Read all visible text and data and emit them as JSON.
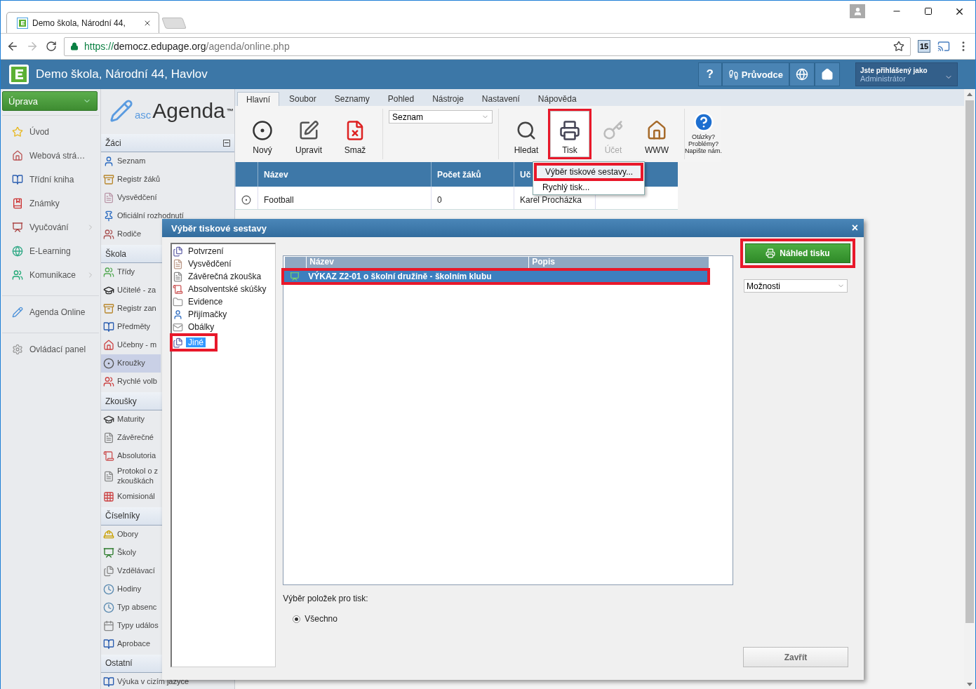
{
  "browser": {
    "tabs": [
      {
        "title": "Demo škola, Národní 44,",
        "selected": true
      }
    ],
    "url": {
      "scheme": "https://",
      "host": "democz.edupage.org",
      "path": "/agenda/online.php"
    },
    "extension_badge": "15"
  },
  "header": {
    "title": "Demo škola, Národní 44, Havlov",
    "help": "?",
    "guide": "Průvodce",
    "user_caption": "Jste přihlášený jako",
    "user_name": "Administrátor"
  },
  "sidebar": {
    "edit_button": "Úprava",
    "groups": [
      [
        {
          "label": "Úvod",
          "submenu": false
        },
        {
          "label": "Webová strá…",
          "submenu": false
        },
        {
          "label": "Třídní kniha",
          "submenu": false
        },
        {
          "label": "Známky",
          "submenu": false
        },
        {
          "label": "Vyučování",
          "submenu": true
        },
        {
          "label": "E-Learning",
          "submenu": false
        },
        {
          "label": "Komunikace",
          "submenu": true
        }
      ],
      [
        {
          "label": "Agenda Online",
          "submenu": false
        }
      ],
      [
        {
          "label": "Ovládací panel",
          "submenu": false
        }
      ]
    ]
  },
  "logo": {
    "prefix": "asc",
    "name": "Agenda",
    "mark": "™"
  },
  "nav": [
    {
      "title": "Žáci",
      "collapsible": true,
      "items": [
        {
          "label": "Seznam",
          "selected": false
        },
        {
          "label": "Registr žáků",
          "selected": false
        },
        {
          "label": "Vysvědčení",
          "selected": false
        },
        {
          "label": "Oficiální rozhodnutí",
          "selected": false
        },
        {
          "label": "Rodiče",
          "selected": false
        }
      ]
    },
    {
      "title": "Škola",
      "items": [
        {
          "label": "Třídy",
          "selected": false
        },
        {
          "label": "Učitelé - za",
          "selected": false
        },
        {
          "label": "Registr zan",
          "selected": false
        },
        {
          "label": "Předměty",
          "selected": false
        },
        {
          "label": "Učebny - m",
          "selected": false
        },
        {
          "label": "Kroužky",
          "selected": true
        },
        {
          "label": "Rychlé volb",
          "selected": false
        }
      ]
    },
    {
      "title": "Zkoušky",
      "items": [
        {
          "label": "Maturity",
          "selected": false
        },
        {
          "label": "Závěrečné",
          "selected": false
        },
        {
          "label": "Absolutoria",
          "selected": false
        },
        {
          "label": "Protokol o z\nzkouškách",
          "selected": false
        },
        {
          "label": "Komisionál",
          "selected": false
        }
      ]
    },
    {
      "title": "Číselníky",
      "items": [
        {
          "label": "Obory",
          "selected": false
        },
        {
          "label": "Školy",
          "selected": false
        },
        {
          "label": "Vzdělávací",
          "selected": false
        },
        {
          "label": "Hodiny",
          "selected": false
        },
        {
          "label": "Typ absenc",
          "selected": false
        },
        {
          "label": "Typy událos",
          "selected": false
        },
        {
          "label": "Aprobace",
          "selected": false
        }
      ]
    },
    {
      "title": "Ostatní",
      "items": [
        {
          "label": "Výuka v cizím jazyce",
          "selected": false
        }
      ]
    }
  ],
  "menu_tabs": [
    {
      "label": "Hlavní",
      "selected": true
    },
    {
      "label": "Soubor",
      "selected": false
    },
    {
      "label": "Seznamy",
      "selected": false
    },
    {
      "label": "Pohled",
      "selected": false
    },
    {
      "label": "Nástroje",
      "selected": false
    },
    {
      "label": "Nastavení",
      "selected": false
    },
    {
      "label": "Nápověda",
      "selected": false
    }
  ],
  "toolbar": {
    "edit_buttons": [
      {
        "label": "Nový",
        "disabled": false,
        "active": false,
        "highlighted": false
      },
      {
        "label": "Upravit",
        "disabled": false,
        "active": false,
        "highlighted": false
      },
      {
        "label": "Smaž",
        "disabled": false,
        "active": false,
        "highlighted": false
      }
    ],
    "view_select": "Seznam",
    "tool_buttons": [
      {
        "label": "Hledat",
        "disabled": false,
        "active": false,
        "highlighted": false
      },
      {
        "label": "Tisk",
        "disabled": false,
        "active": true,
        "highlighted": true
      },
      {
        "label": "Účet",
        "disabled": true,
        "active": false,
        "highlighted": false
      },
      {
        "label": "WWW",
        "disabled": false,
        "active": false,
        "highlighted": false
      }
    ],
    "help_link": "Otázky?\nProblémy?\nNapište nám."
  },
  "table": {
    "columns": [
      "Název",
      "Počet žáků",
      "Uč"
    ],
    "rows": [
      {
        "cells": [
          "Football",
          "0",
          "Karel Procházka"
        ]
      }
    ]
  },
  "print_menu": [
    {
      "label": "Výběr tiskové sestavy...",
      "highlighted": true
    },
    {
      "label": "Rychlý tisk...",
      "highlighted": false
    }
  ],
  "dialog": {
    "title": "Výběr tiskové sestavy",
    "close": "×",
    "categories": [
      {
        "label": "Potvrzení",
        "selected": false,
        "highlighted": false
      },
      {
        "label": "Vysvědčení",
        "selected": false,
        "highlighted": false
      },
      {
        "label": "Závěrečná zkouška",
        "selected": false,
        "highlighted": false
      },
      {
        "label": "Absolventské skúšky",
        "selected": false,
        "highlighted": false
      },
      {
        "label": "Evidence",
        "selected": false,
        "highlighted": false
      },
      {
        "label": "Přijímačky",
        "selected": false,
        "highlighted": false
      },
      {
        "label": "Obálky",
        "selected": false,
        "highlighted": false
      },
      {
        "label": "Jiné",
        "selected": true,
        "highlighted": true
      }
    ],
    "columns": [
      "Název",
      "Popis"
    ],
    "reports": [
      {
        "name": "VÝKAZ Z2-01 o školní družině - školním klubu",
        "selected": true,
        "highlighted": true
      }
    ],
    "items_label": "Výběr položek pro tisk:",
    "radios": [
      {
        "label": "Všechno",
        "selected": true
      }
    ],
    "preview_button": {
      "label": "Náhled tisku",
      "highlighted": true
    },
    "options_select": "Možnosti",
    "close_button": "Zavřít"
  }
}
